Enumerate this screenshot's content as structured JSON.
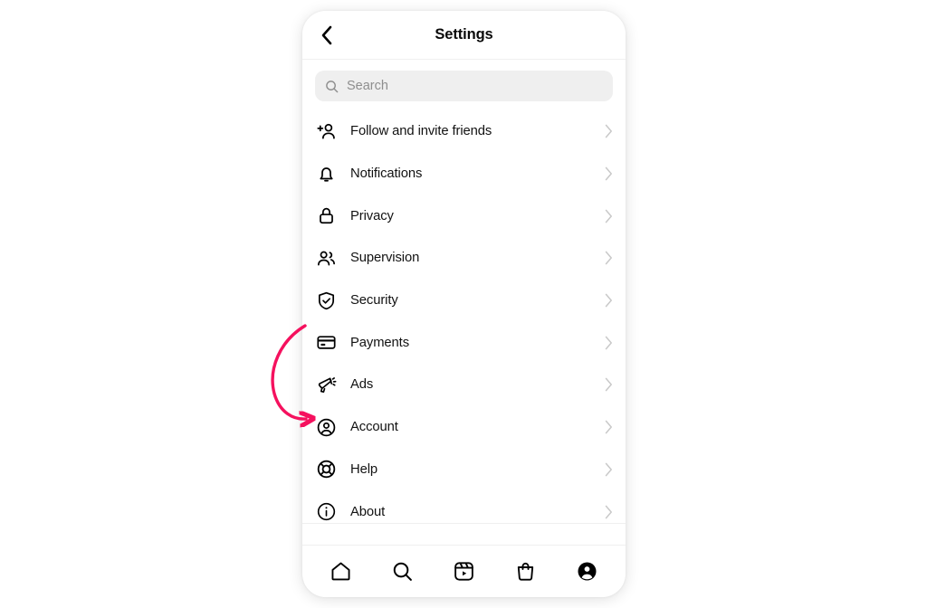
{
  "screen": {
    "background_color": "#ffffff",
    "device_background": "#ffffff"
  },
  "header": {
    "title": "Settings",
    "back_icon": "chevron-left-icon"
  },
  "search": {
    "placeholder": "Search",
    "value": "",
    "icon": "search-icon",
    "background_color": "#efefef",
    "placeholder_color": "#8e8e8e"
  },
  "settings_list": {
    "chevron_icon": "chevron-right-icon",
    "chevron_color": "#c9c9c9",
    "items": [
      {
        "label": "Follow and invite friends",
        "icon": "add-person-icon"
      },
      {
        "label": "Notifications",
        "icon": "bell-icon"
      },
      {
        "label": "Privacy",
        "icon": "lock-icon"
      },
      {
        "label": "Supervision",
        "icon": "two-people-icon"
      },
      {
        "label": "Security",
        "icon": "shield-check-icon"
      },
      {
        "label": "Payments",
        "icon": "credit-card-icon"
      },
      {
        "label": "Ads",
        "icon": "megaphone-icon"
      },
      {
        "label": "Account",
        "icon": "account-circle-icon"
      },
      {
        "label": "Help",
        "icon": "lifebuoy-icon"
      },
      {
        "label": "About",
        "icon": "info-circle-icon"
      }
    ]
  },
  "tabbar": {
    "items": [
      {
        "name": "home",
        "icon": "home-icon",
        "active": false
      },
      {
        "name": "search",
        "icon": "search-icon",
        "active": false
      },
      {
        "name": "reels",
        "icon": "reels-icon",
        "active": false
      },
      {
        "name": "shop",
        "icon": "shop-bag-icon",
        "active": false
      },
      {
        "name": "profile",
        "icon": "profile-filled-icon",
        "active": true
      }
    ]
  },
  "annotation": {
    "type": "curved-arrow",
    "color": "#f5115e",
    "points_to": "Account",
    "stroke_width": 3.4
  }
}
